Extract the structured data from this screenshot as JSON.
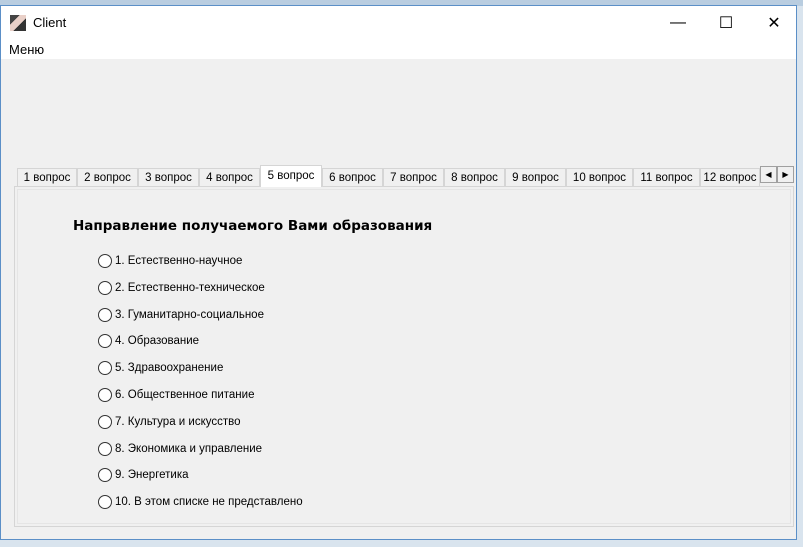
{
  "window": {
    "title": "Client",
    "minimize": "—",
    "maximize": "☐",
    "close": "✕"
  },
  "menu": {
    "label": "Меню"
  },
  "tabs": [
    "1 вопрос",
    "2 вопрос",
    "3 вопрос",
    "4 вопрос",
    "5 вопрос",
    "6 вопрос",
    "7 вопрос",
    "8 вопрос",
    "9 вопрос",
    "10 вопрос",
    "11 вопрос",
    "12 вопрос"
  ],
  "selected_tab": "5 вопрос",
  "scroll": {
    "left": "◀",
    "right": "▶"
  },
  "question": {
    "title": "Направление получаемого Вами образования",
    "options": [
      "1. Естественно-научное",
      "2. Естественно-техническое",
      "3. Гуманитарно-социальное",
      "4. Образование",
      "5. Здравоохранение",
      "6. Общественное питание",
      "7. Культура и искусство",
      "8. Экономика и управление",
      "9. Энергетика",
      "10. В этом списке не представлено"
    ]
  }
}
